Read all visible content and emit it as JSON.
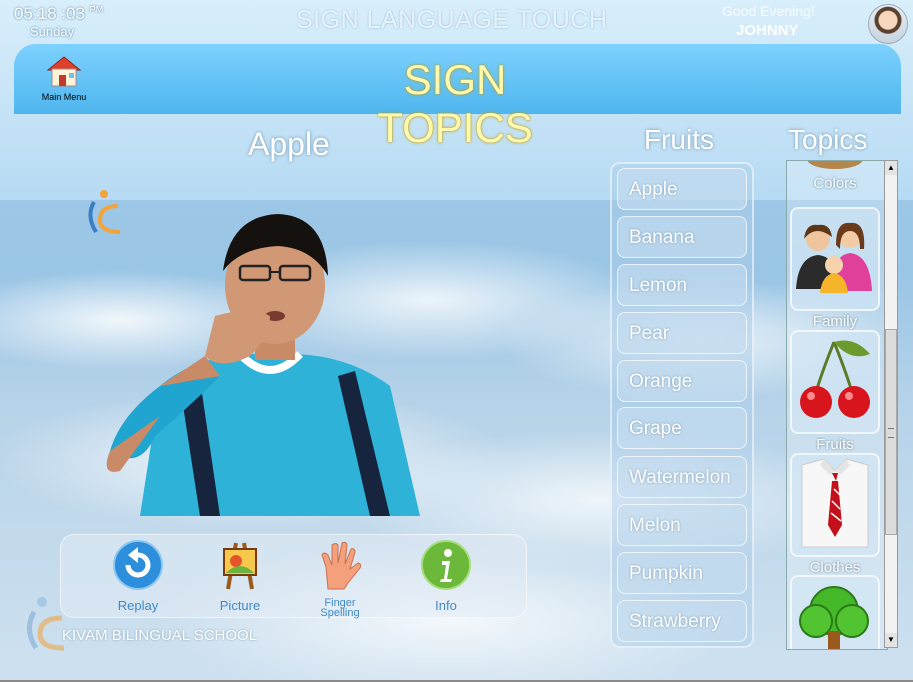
{
  "status": {
    "time": "05:18 :03",
    "ampm": "PM",
    "day": "Sunday",
    "app_title": "SIGN LANGUAGE TOUCH",
    "greeting": "Good Evening!",
    "user": "JOHNNY"
  },
  "header": {
    "main_menu_label": "Main Menu",
    "title_line1": "SIGN",
    "title_line2": "TOPICS"
  },
  "current_sign": "Apple",
  "list_heading": "Fruits",
  "topics_heading": "Topics",
  "fruits": [
    "Apple",
    "Banana",
    "Lemon",
    "Pear",
    "Orange",
    "Grape",
    "Watermelon",
    "Melon",
    "Pumpkin",
    "Strawberry"
  ],
  "topics": [
    "Colors",
    "Family",
    "Fruits",
    "Clothes"
  ],
  "controls": {
    "replay": "Replay",
    "picture": "Picture",
    "finger_spelling_1": "Finger",
    "finger_spelling_2": "Spelling",
    "info": "Info"
  },
  "school_name": "KIVAM BILINGUAL SCHOOL",
  "colors": {
    "header_blue": "#4fb6ee",
    "title_yellow": "#fff9b0",
    "control_label_blue": "#3f89c9"
  }
}
